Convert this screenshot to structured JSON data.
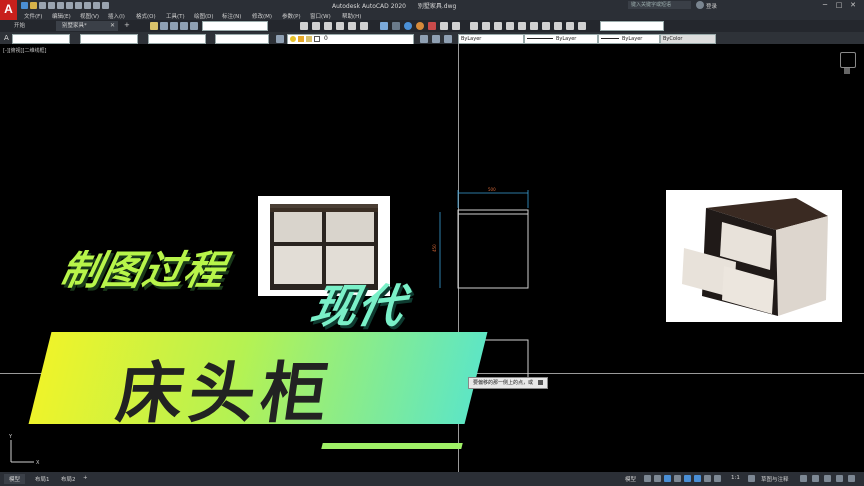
{
  "window": {
    "app_logo": "A",
    "app_title": "Autodesk AutoCAD 2020",
    "file_name": "别墅家具.dwg",
    "search_placeholder": "键入关键字或短语",
    "user_label": "登录"
  },
  "menu": [
    "文件(F)",
    "编辑(E)",
    "视图(V)",
    "插入(I)",
    "格式(O)",
    "工具(T)",
    "绘图(D)",
    "标注(N)",
    "修改(M)",
    "参数(P)",
    "窗口(W)",
    "帮助(H)"
  ],
  "tabs": {
    "start": "开始",
    "drawing": "别墅家具*",
    "add": "+"
  },
  "properties": {
    "layer": "0",
    "color": "ByLayer",
    "linetype": "ByLayer",
    "lineweight": "ByLayer",
    "plotstyle": "ByColor"
  },
  "viewport": {
    "label": "[-][俯视][二维线框]",
    "dimension_width": "500",
    "dimension_height": "450"
  },
  "overlay": {
    "line1": "制图过程",
    "line2": "现代",
    "main_title": "床头柜"
  },
  "command_tip": "要偏移的那一侧上的点，或",
  "status": {
    "model_tab": "模型",
    "layout1": "布局1",
    "layout2": "布局2",
    "add": "+",
    "model_button": "模型",
    "scale": "1:1",
    "workspace": "草图与注释"
  },
  "colors": {
    "banner_start": "#eef32a",
    "banner_end": "#5ee6c4",
    "text_green": "#b8f54a",
    "text_cyan": "#7af0c8",
    "accent_red": "#c8201c"
  }
}
